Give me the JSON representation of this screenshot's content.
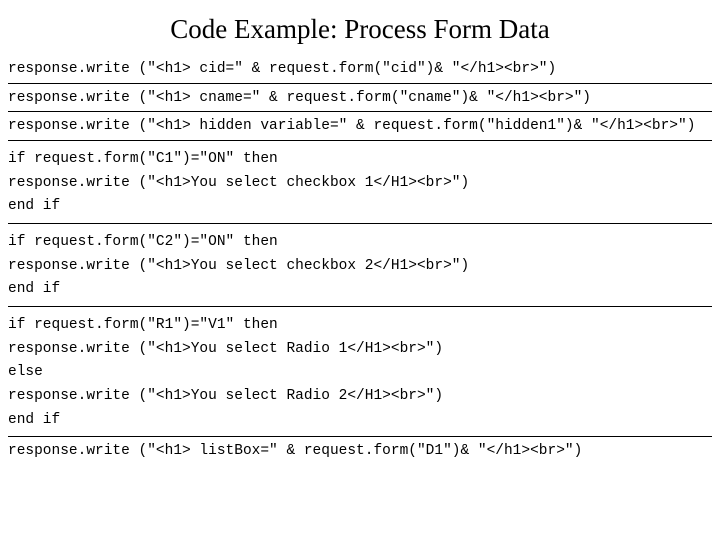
{
  "title": "Code Example: Process Form Data",
  "lines": {
    "l1": "response.write (\"<h1> cid=\" & request.form(\"cid\")& \"</h1><br>\")",
    "l2": "response.write (\"<h1> cname=\" & request.form(\"cname\")& \"</h1><br>\")",
    "l3": "response.write (\"<h1> hidden variable=\" & request.form(\"hidden1\")& \"</h1><br>\")",
    "l4": "if request.form(\"C1\")=\"ON\" then",
    "l5": "response.write (\"<h1>You select checkbox 1</H1><br>\")",
    "l6": "end if",
    "l7": "if request.form(\"C2\")=\"ON\" then",
    "l8": "response.write (\"<h1>You select checkbox 2</H1><br>\")",
    "l9": "end if",
    "l10": "if request.form(\"R1\")=\"V1\" then",
    "l11": "response.write (\"<h1>You select Radio 1</H1><br>\")",
    "l12": "else",
    "l13": "response.write (\"<h1>You select Radio 2</H1><br>\")",
    "l14": "end if",
    "l15": "response.write (\"<h1> listBox=\" & request.form(\"D1\")& \"</h1><br>\")"
  }
}
